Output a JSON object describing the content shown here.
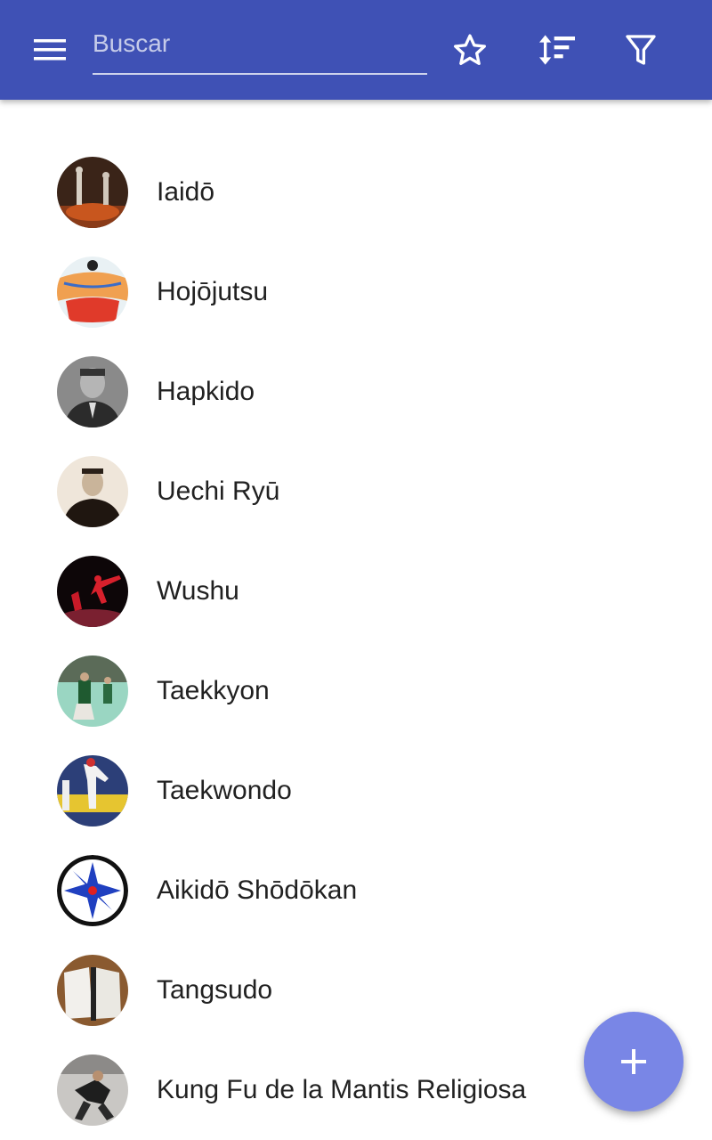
{
  "toolbar": {
    "menu_icon": "menu-icon",
    "search_placeholder": "Buscar",
    "search_value": "",
    "favorites_icon": "star-outline-icon",
    "sort_icon": "sort-icon",
    "filter_icon": "filter-icon",
    "color": "#3f51b5"
  },
  "items": [
    {
      "label": "Iaidō"
    },
    {
      "label": "Hojōjutsu"
    },
    {
      "label": "Hapkido"
    },
    {
      "label": "Uechi Ryū"
    },
    {
      "label": "Wushu"
    },
    {
      "label": "Taekkyon"
    },
    {
      "label": "Taekwondo"
    },
    {
      "label": "Aikidō Shōdōkan"
    },
    {
      "label": "Tangsudo"
    },
    {
      "label": "Kung Fu de la Mantis Religiosa"
    }
  ],
  "fab": {
    "icon": "plus-icon",
    "color": "#7986e6"
  }
}
